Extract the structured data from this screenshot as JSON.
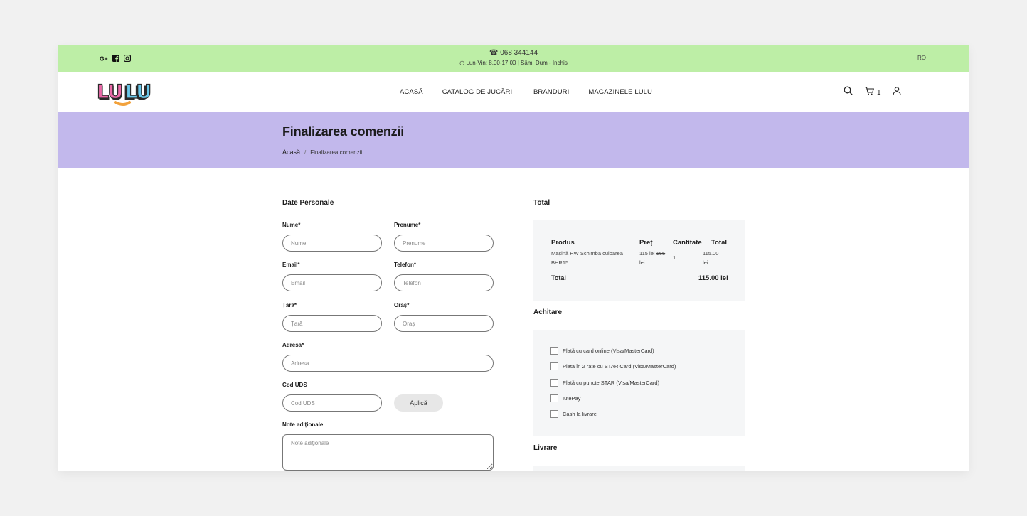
{
  "topbar": {
    "phone": "068 344144",
    "hours": "Lun-Vin: 8.00-17.00 | Sâm, Dum - Inchis",
    "language": "RO",
    "social_icons": [
      "google-plus-icon",
      "facebook-icon",
      "instagram-icon"
    ],
    "background": "#bdeea6"
  },
  "header": {
    "logo_text": "LULU",
    "nav": [
      "ACASĂ",
      "CATALOG DE JUCĂRII",
      "BRANDURI",
      "MAGAZINELE LULU"
    ],
    "cart_count": "1"
  },
  "banner": {
    "title": "Finalizarea comenzii",
    "breadcrumb_home": "Acasă",
    "breadcrumb_current": "Finalizarea comenzii",
    "background": "#c2b8ec"
  },
  "form": {
    "heading": "Date Personale",
    "nume_label": "Nume*",
    "nume_placeholder": "Nume",
    "prenume_label": "Prenume*",
    "prenume_placeholder": "Prenume",
    "email_label": "Email*",
    "email_placeholder": "Email",
    "telefon_label": "Telefon*",
    "telefon_placeholder": "Telefon",
    "tara_label": "Țară*",
    "tara_placeholder": "Țară",
    "oras_label": "Oraș*",
    "oras_placeholder": "Oraș",
    "adresa_label": "Adresa*",
    "adresa_placeholder": "Adresa",
    "cod_label": "Cod UDS",
    "cod_placeholder": "Cod UDS",
    "apply_label": "Aplică",
    "note_label": "Note adiționale",
    "note_placeholder": "Note adiționale"
  },
  "total": {
    "heading": "Total",
    "columns": [
      "Produs",
      "Preț",
      "Cantitate",
      "Total"
    ],
    "item": {
      "name_line1": "Mașină HW Schimba culoarea",
      "name_line2": "BHR15",
      "price": "115 lei",
      "old_price": "165",
      "price_unit": "lei",
      "quantity": "1",
      "total_line1": "115.00",
      "total_line2": "lei"
    },
    "total_label": "Total",
    "total_value": "115.00 lei"
  },
  "payment": {
    "heading": "Achitare",
    "options": [
      "Plată cu card online (Visa/MasterCard)",
      "Plata în 2 rate cu STAR Card (Visa/MasterCard)",
      "Plată cu puncte STAR (Visa/MasterCard)",
      "IutePay",
      "Cash la livrare"
    ]
  },
  "delivery": {
    "heading": "Livrare"
  }
}
